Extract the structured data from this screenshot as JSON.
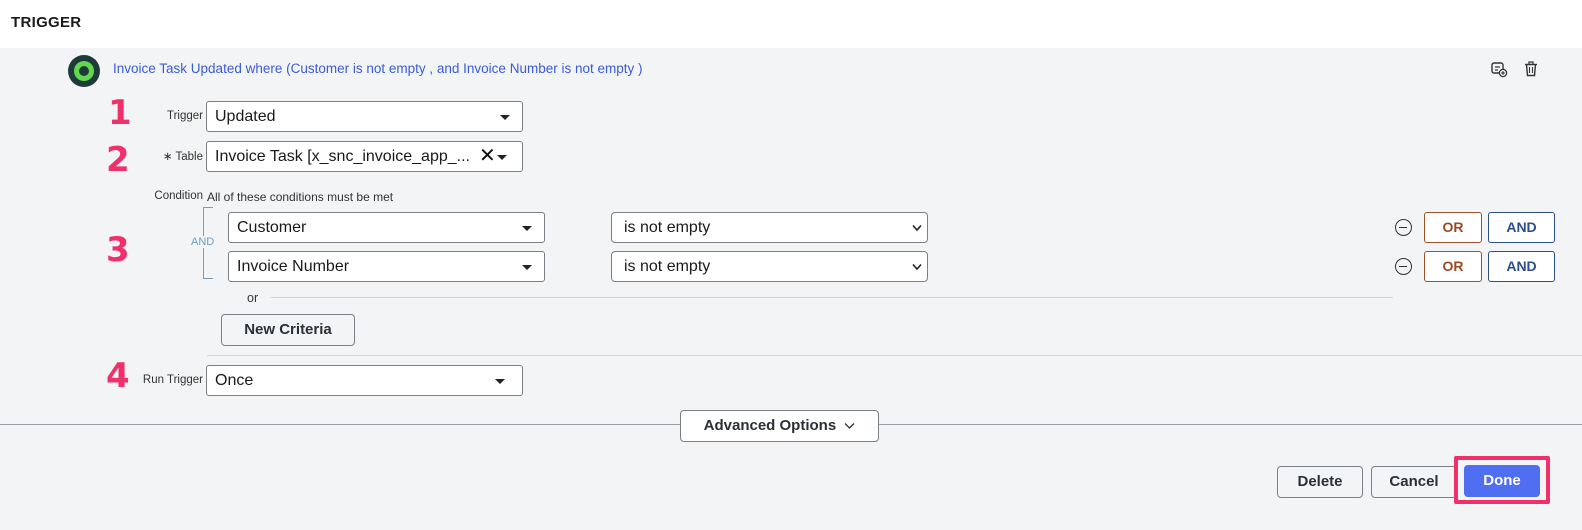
{
  "header": {
    "title": "TRIGGER"
  },
  "summary": {
    "text": "Invoice Task Updated where (Customer is not empty , and Invoice Number is not empty )",
    "avatar_icon": "trigger-status-icon",
    "actions": [
      "add-note-icon",
      "trash-icon"
    ]
  },
  "steps": [
    "1",
    "2",
    "3",
    "4"
  ],
  "trigger": {
    "label": "Trigger",
    "value": "Updated"
  },
  "table": {
    "label": "Table",
    "required_mark": "∗",
    "value": "Invoice Task [x_snc_invoice_app_...",
    "clear_icon": "✕"
  },
  "condition": {
    "label": "Condition",
    "header": "All of these conditions must be met",
    "group_operator": "AND",
    "rows": [
      {
        "field": "Customer",
        "operator": "is not empty",
        "or_label": "OR",
        "and_label": "AND"
      },
      {
        "field": "Invoice Number",
        "operator": "is not empty",
        "or_label": "OR",
        "and_label": "AND"
      }
    ],
    "or_separator": "or",
    "new_criteria_label": "New Criteria"
  },
  "run_trigger": {
    "label": "Run Trigger",
    "value": "Once"
  },
  "advanced_options": {
    "label": "Advanced Options",
    "chevron": "⌄"
  },
  "footer": {
    "delete_label": "Delete",
    "cancel_label": "Cancel",
    "done_label": "Done"
  },
  "colors": {
    "accent": "#4f6ef2",
    "highlight": "#f0306a",
    "or_color": "#9b4a26",
    "and_color": "#2c4f8a",
    "link_blue": "#3b5bdb"
  }
}
